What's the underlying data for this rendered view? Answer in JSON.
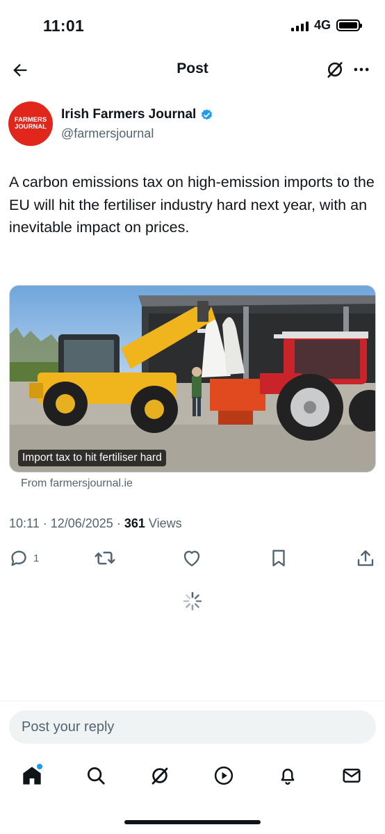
{
  "status_bar": {
    "time": "11:01",
    "network": "4G"
  },
  "nav": {
    "title": "Post"
  },
  "author": {
    "name": "Irish Farmers Journal",
    "handle": "@farmersjournal",
    "avatar_line1": "FARMERS",
    "avatar_line2": "JOURNAL",
    "avatar_color": "#e1261c",
    "verified": true
  },
  "post": {
    "text": "A carbon emissions tax on high-emission imports to the EU will hit the fertiliser industry hard next year, with an inevitable impact on prices.",
    "media_caption": "Import tax to hit fertiliser hard",
    "media_source": "From farmersjournal.ie",
    "time": "10:11",
    "date": "12/06/2025",
    "views_count": "361",
    "views_label": "Views"
  },
  "actions": {
    "reply_count": "1",
    "icons": [
      "reply-icon",
      "repost-icon",
      "like-icon",
      "bookmark-icon",
      "share-icon"
    ]
  },
  "reply": {
    "placeholder": "Post your reply"
  },
  "tab_bar": {
    "items": [
      "home-icon",
      "search-icon",
      "grok-icon",
      "video-icon",
      "notifications-icon",
      "messages-icon"
    ]
  },
  "colors": {
    "accent": "#1d9bf0",
    "secondary_text": "#536471",
    "primary_text": "#0f1419"
  }
}
